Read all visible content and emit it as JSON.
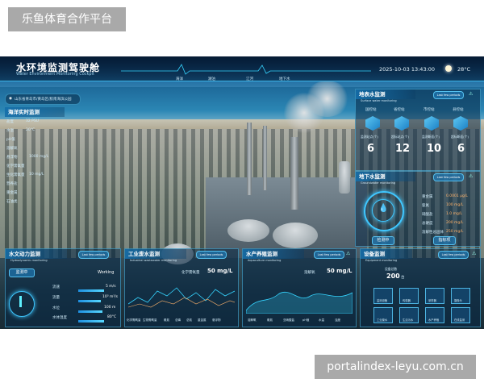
{
  "watermark_top": "乐鱼体育合作平台",
  "watermark_bottom": "portalindex-leyu.com.cn",
  "header": {
    "title": "水环境监测驾驶舱",
    "subtitle": "Water Environment Monitoring Cockpit",
    "nav": [
      "海洋",
      "湖泊",
      "江河",
      "地下水"
    ],
    "datetime": "2025-10-03 13:43:00",
    "temperature": "28°C"
  },
  "left_panel": {
    "location": "山东省青岛市/黄岛区/胶南海滨公园",
    "section": "海洋实时监测",
    "rows": [
      {
        "label": "盐度",
        "value": "32 PSU"
      },
      {
        "label": "水温",
        "value": "20°C"
      },
      {
        "label": "pH值",
        "value": ""
      },
      {
        "label": "溶解氧",
        "value": ""
      },
      {
        "label": "悬浮物",
        "value": "1000 mg/L"
      },
      {
        "label": "化学需氧量",
        "value": ""
      },
      {
        "label": "生化需氧量",
        "value": "10 mg/L"
      },
      {
        "label": "营养盐",
        "value": ""
      },
      {
        "label": "重金属",
        "value": ""
      },
      {
        "label": "石油类",
        "value": ""
      }
    ]
  },
  "surface": {
    "title": "地表水监测",
    "subtitle": "Surface water monitoring",
    "tag": "Last few periods",
    "icons": [
      "国控站",
      "省控站",
      "市控站",
      "县控站"
    ],
    "metric_labels": [
      "监测站点(个)",
      "超标站点(个)",
      "监测断面(个)",
      "超标断面(个)"
    ],
    "values": [
      "6",
      "12",
      "10",
      "6"
    ]
  },
  "groundwater": {
    "title": "地下水监测",
    "subtitle": "Groundwater monitoring",
    "tag": "Last few periods",
    "rows": [
      {
        "label": "重金属",
        "value": "0.0001 μg/L"
      },
      {
        "label": "氨氮",
        "value": "100 mg/L"
      },
      {
        "label": "硝酸盐",
        "value": "1.0 mg/L"
      },
      {
        "label": "总硬度",
        "value": "200 mg/L"
      },
      {
        "label": "溶解性总固体",
        "value": "250 mg/L"
      }
    ],
    "btn_left": "检测中",
    "btn_right": "指标项"
  },
  "hydro": {
    "title": "水文动力监测",
    "subtitle": "Hydrodynamic monitoring",
    "tag": "Last few periods",
    "status_a": "监测中",
    "status_b": "Working",
    "rows": [
      {
        "label": "流速",
        "value": "5 m/s"
      },
      {
        "label": "流量",
        "value": "10³ m³/s"
      },
      {
        "label": "水位",
        "value": "100 m"
      },
      {
        "label": "水体温度",
        "value": "80°C"
      }
    ]
  },
  "industry": {
    "title": "工业废水监测",
    "subtitle": "Industrial wastewater monitoring",
    "tag": "Last few periods",
    "label": "化学需氧量",
    "value": "50 mg/L",
    "tabs": [
      "化学需氧量",
      "生物需氧量",
      "氨氮",
      "总磷",
      "总氮",
      "重金属",
      "悬浮物"
    ]
  },
  "aqua": {
    "title": "水产养殖监测",
    "subtitle": "Aquaculture monitoring",
    "tag": "Last few periods",
    "label": "溶解氧",
    "value": "50 mg/L",
    "tabs": [
      "溶解氧",
      "氨氮",
      "亚硝酸盐",
      "pH值",
      "水温",
      "浊度"
    ]
  },
  "equipment": {
    "title": "设备监测",
    "subtitle": "Equipment monitoring",
    "tag": "Last few periods",
    "count_label": "设备总数",
    "count": "200",
    "unit": "台",
    "tiles": [
      "监测设备",
      "传感器",
      "采样器",
      "摄像头",
      "工业废水",
      "生活污水",
      "水产养殖",
      "在线监测"
    ]
  }
}
